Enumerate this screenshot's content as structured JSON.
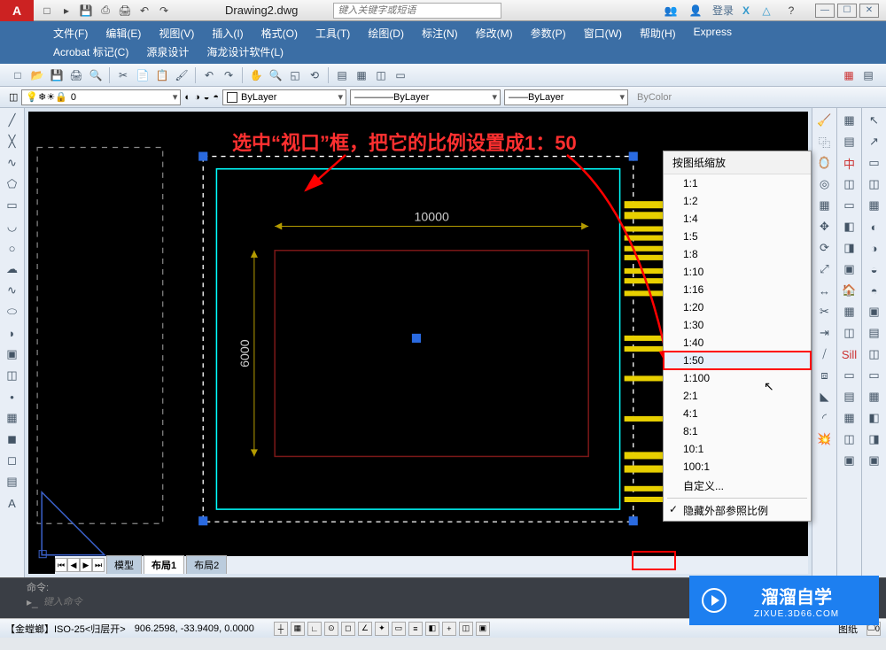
{
  "title": "Drawing2.dwg",
  "search_placeholder": "键入关键字或短语",
  "login_label": "登录",
  "menus": [
    "文件(F)",
    "编辑(E)",
    "视图(V)",
    "插入(I)",
    "格式(O)",
    "工具(T)",
    "绘图(D)",
    "标注(N)",
    "修改(M)",
    "参数(P)",
    "窗口(W)",
    "帮助(H)",
    "Express",
    "Acrobat 标记(C)",
    "源泉设计",
    "海龙设计软件(L)"
  ],
  "layer_combo": "0",
  "bylayer1": "ByLayer",
  "bylayer2": "ByLayer",
  "bylayer3": "ByLayer",
  "bycolor": "ByColor",
  "annotation": "选中“视口”框，把它的比例设置成1：50",
  "dim_h": "10000",
  "dim_v": "6000",
  "scale_menu": {
    "header": "按图纸缩放",
    "items": [
      "1:1",
      "1:2",
      "1:4",
      "1:5",
      "1:8",
      "1:10",
      "1:16",
      "1:20",
      "1:30",
      "1:40",
      "1:50",
      "1:100",
      "2:1",
      "4:1",
      "8:1",
      "10:1",
      "100:1"
    ],
    "custom": "自定义...",
    "hide_xref": "隐藏外部参照比例",
    "selected": "1:50"
  },
  "tabs": {
    "model": "模型",
    "layout1": "布局1",
    "layout2": "布局2"
  },
  "cmd": {
    "label": "命令:",
    "placeholder": "键入命令"
  },
  "status": {
    "style": "【金螳螂】ISO-25<归层开>",
    "coords": "906.2598, -33.9409, 0.0000",
    "paper": "图纸",
    "scale_btn": "0"
  },
  "watermark": {
    "main": "溜溜自学",
    "sub": "ZIXUE.3D66.COM"
  }
}
